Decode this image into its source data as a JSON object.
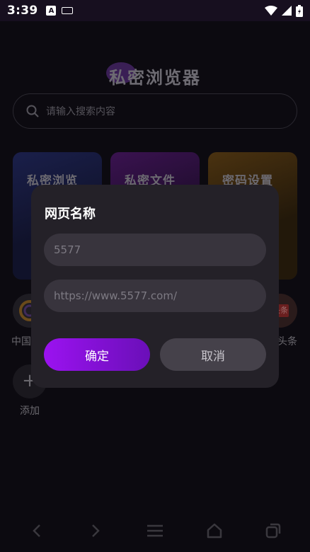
{
  "status_bar": {
    "time": "3:39",
    "notif_a_label": "A"
  },
  "app": {
    "title": "私密浏览器",
    "search_placeholder": "请输入搜索内容",
    "cards": [
      {
        "label": "私密浏览"
      },
      {
        "label": "私密文件"
      },
      {
        "label": "密码设置"
      }
    ],
    "shortcuts": [
      {
        "label": "中国"
      },
      {
        "label": "头条"
      }
    ],
    "shortcut_badge": "头条",
    "add_label": "添加",
    "add_symbol": "+"
  },
  "dialog": {
    "title": "网页名称",
    "name_value": "5577",
    "url_placeholder": "https://www.5577.com/",
    "confirm_label": "确定",
    "cancel_label": "取消"
  },
  "colors": {
    "accent_start": "#9b12f0",
    "accent_end": "#6a0fb8",
    "dialog_bg": "#242128",
    "field_bg": "#38343d"
  }
}
